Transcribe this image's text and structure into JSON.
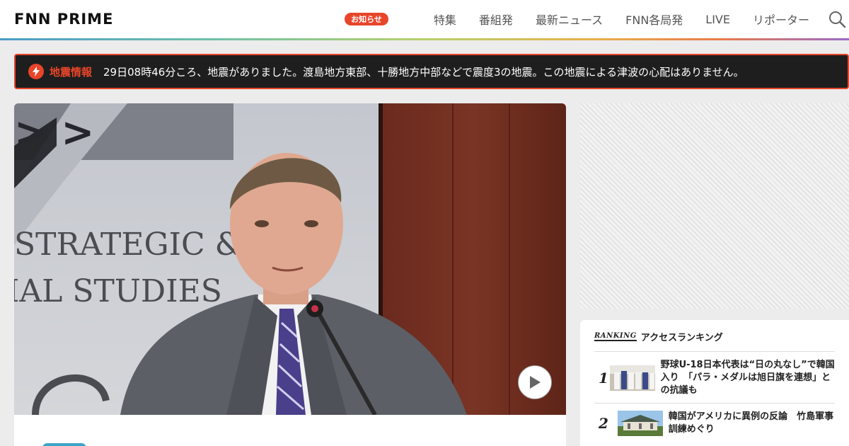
{
  "header": {
    "logo_text": "FNN PRIME",
    "notice_badge": "お知らせ",
    "nav": [
      "特集",
      "番組発",
      "最新ニュース",
      "FNN各局発",
      "LIVE",
      "リポーター"
    ],
    "search_icon": "search-icon"
  },
  "alert": {
    "icon": "lightning-icon",
    "label": "地震情報",
    "text": "29日08時46分ころ、地震がありました。渡島地方東部、十勝地方中部などで震度3の地震。この地震による津波の心配はありません。"
  },
  "video": {
    "backdrop_lines": [
      "STRATEGIC &",
      "IAL STUDIES"
    ],
    "play_icon": "play-icon"
  },
  "ranking": {
    "label_en": "RANKING",
    "title": "アクセスランキング",
    "items": [
      {
        "rank": "1",
        "text": "野球U-18日本代表は“日の丸なし”で韓国入り　「パラ・メダルは旭日旗を連想」との抗議も"
      },
      {
        "rank": "2",
        "text": "韓国がアメリカに異例の反論　竹島軍事訓練めぐり"
      }
    ]
  },
  "colors": {
    "accent": "#e8452a",
    "alert_bg": "#1e1e1e",
    "page_bg": "#ececec"
  }
}
